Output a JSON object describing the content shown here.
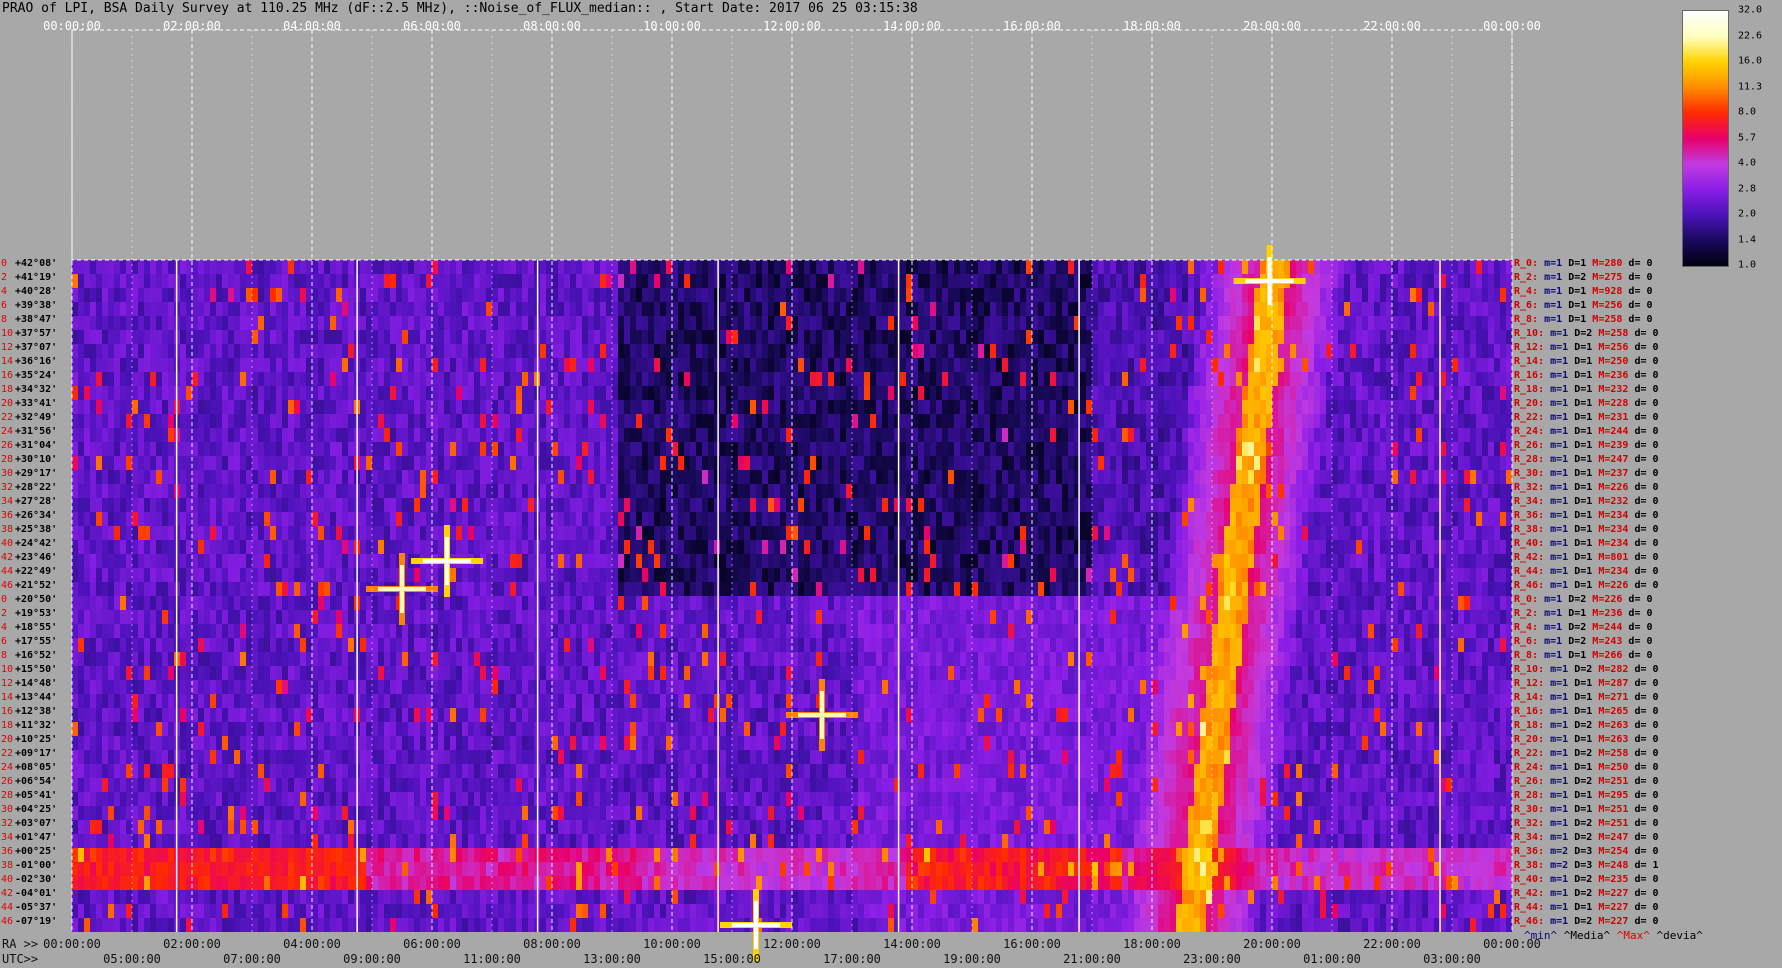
{
  "title": "PRAO of LPI, BSA Daily Survey at 110.25 MHz (dF::2.5 MHz), ::Noise_of_FLUX_median:: , Start Date: 2017 06 25 03:15:38",
  "top_ticks": [
    "00:00:00",
    "02:00:00",
    "04:00:00",
    "06:00:00",
    "08:00:00",
    "10:00:00",
    "12:00:00",
    "14:00:00",
    "16:00:00",
    "18:00:00",
    "20:00:00",
    "22:00:00",
    "00:00:00"
  ],
  "ra_label": "RA >>",
  "ra_ticks": [
    "00:00:00",
    "02:00:00",
    "04:00:00",
    "06:00:00",
    "08:00:00",
    "10:00:00",
    "12:00:00",
    "14:00:00",
    "16:00:00",
    "18:00:00",
    "20:00:00",
    "22:00:00",
    "00:00:00"
  ],
  "utc_label": "UTC>>",
  "utc_ticks": [
    "05:00:00",
    "07:00:00",
    "09:00:00",
    "11:00:00",
    "13:00:00",
    "15:00:00",
    "17:00:00",
    "19:00:00",
    "21:00:00",
    "23:00:00",
    "01:00:00",
    "03:00:00"
  ],
  "colorbar_ticks": [
    "32.0",
    "22.6",
    "16.0",
    "11.3",
    "8.0",
    "5.7",
    "4.0",
    "2.8",
    "2.0",
    "1.4",
    "1.0"
  ],
  "legend": {
    "min": "^min^",
    "median": "^Media^",
    "max": "^Max^",
    "dev": "^devia^"
  },
  "dec_labels": [
    {
      "i": "0",
      "v": "+42°08'"
    },
    {
      "i": "2",
      "v": "+41°19'"
    },
    {
      "i": "4",
      "v": "+40°28'"
    },
    {
      "i": "6",
      "v": "+39°38'"
    },
    {
      "i": "8",
      "v": "+38°47'"
    },
    {
      "i": "10",
      "v": "+37°57'"
    },
    {
      "i": "12",
      "v": "+37°07'"
    },
    {
      "i": "14",
      "v": "+36°16'"
    },
    {
      "i": "16",
      "v": "+35°24'"
    },
    {
      "i": "18",
      "v": "+34°32'"
    },
    {
      "i": "20",
      "v": "+33°41'"
    },
    {
      "i": "22",
      "v": "+32°49'"
    },
    {
      "i": "24",
      "v": "+31°56'"
    },
    {
      "i": "26",
      "v": "+31°04'"
    },
    {
      "i": "28",
      "v": "+30°10'"
    },
    {
      "i": "30",
      "v": "+29°17'"
    },
    {
      "i": "32",
      "v": "+28°22'"
    },
    {
      "i": "34",
      "v": "+27°28'"
    },
    {
      "i": "36",
      "v": "+26°34'"
    },
    {
      "i": "38",
      "v": "+25°38'"
    },
    {
      "i": "40",
      "v": "+24°42'"
    },
    {
      "i": "42",
      "v": "+23°46'"
    },
    {
      "i": "44",
      "v": "+22°49'"
    },
    {
      "i": "46",
      "v": "+21°52'"
    },
    {
      "i": "0",
      "v": "+20°50'"
    },
    {
      "i": "2",
      "v": "+19°53'"
    },
    {
      "i": "4",
      "v": "+18°55'"
    },
    {
      "i": "6",
      "v": "+17°55'"
    },
    {
      "i": "8",
      "v": "+16°52'"
    },
    {
      "i": "10",
      "v": "+15°50'"
    },
    {
      "i": "12",
      "v": "+14°48'"
    },
    {
      "i": "14",
      "v": "+13°44'"
    },
    {
      "i": "16",
      "v": "+12°38'"
    },
    {
      "i": "18",
      "v": "+11°32'"
    },
    {
      "i": "20",
      "v": "+10°25'"
    },
    {
      "i": "22",
      "v": "+09°17'"
    },
    {
      "i": "24",
      "v": "+08°05'"
    },
    {
      "i": "26",
      "v": "+06°54'"
    },
    {
      "i": "28",
      "v": "+05°41'"
    },
    {
      "i": "30",
      "v": "+04°25'"
    },
    {
      "i": "32",
      "v": "+03°07'"
    },
    {
      "i": "34",
      "v": "+01°47'"
    },
    {
      "i": "36",
      "v": "+00°25'"
    },
    {
      "i": "38",
      "v": "-01°00'"
    },
    {
      "i": "40",
      "v": "-02°30'"
    },
    {
      "i": "42",
      "v": "-04°01'"
    },
    {
      "i": "44",
      "v": "-05°37'"
    },
    {
      "i": "46",
      "v": "-07°19'"
    }
  ],
  "row_labels": [
    {
      "r": "R_0:",
      "m": "m=1",
      "d": "D=1",
      "mx": "M=280",
      "dv": "d= 0"
    },
    {
      "r": "R_2:",
      "m": "m=1",
      "d": "D=2",
      "mx": "M=275",
      "dv": "d= 0"
    },
    {
      "r": "R_4:",
      "m": "m=1",
      "d": "D=1",
      "mx": "M=928",
      "dv": "d= 0"
    },
    {
      "r": "R_6:",
      "m": "m=1",
      "d": "D=1",
      "mx": "M=256",
      "dv": "d= 0"
    },
    {
      "r": "R_8:",
      "m": "m=1",
      "d": "D=1",
      "mx": "M=258",
      "dv": "d= 0"
    },
    {
      "r": "R_10:",
      "m": "m=1",
      "d": "D=2",
      "mx": "M=258",
      "dv": "d= 0"
    },
    {
      "r": "R_12:",
      "m": "m=1",
      "d": "D=1",
      "mx": "M=256",
      "dv": "d= 0"
    },
    {
      "r": "R_14:",
      "m": "m=1",
      "d": "D=1",
      "mx": "M=250",
      "dv": "d= 0"
    },
    {
      "r": "R_16:",
      "m": "m=1",
      "d": "D=1",
      "mx": "M=236",
      "dv": "d= 0"
    },
    {
      "r": "R_18:",
      "m": "m=1",
      "d": "D=1",
      "mx": "M=232",
      "dv": "d= 0"
    },
    {
      "r": "R_20:",
      "m": "m=1",
      "d": "D=1",
      "mx": "M=228",
      "dv": "d= 0"
    },
    {
      "r": "R_22:",
      "m": "m=1",
      "d": "D=1",
      "mx": "M=231",
      "dv": "d= 0"
    },
    {
      "r": "R_24:",
      "m": "m=1",
      "d": "D=1",
      "mx": "M=244",
      "dv": "d= 0"
    },
    {
      "r": "R_26:",
      "m": "m=1",
      "d": "D=1",
      "mx": "M=239",
      "dv": "d= 0"
    },
    {
      "r": "R_28:",
      "m": "m=1",
      "d": "D=1",
      "mx": "M=247",
      "dv": "d= 0"
    },
    {
      "r": "R_30:",
      "m": "m=1",
      "d": "D=1",
      "mx": "M=237",
      "dv": "d= 0"
    },
    {
      "r": "R_32:",
      "m": "m=1",
      "d": "D=1",
      "mx": "M=226",
      "dv": "d= 0"
    },
    {
      "r": "R_34:",
      "m": "m=1",
      "d": "D=1",
      "mx": "M=232",
      "dv": "d= 0"
    },
    {
      "r": "R_36:",
      "m": "m=1",
      "d": "D=1",
      "mx": "M=234",
      "dv": "d= 0"
    },
    {
      "r": "R_38:",
      "m": "m=1",
      "d": "D=1",
      "mx": "M=234",
      "dv": "d= 0"
    },
    {
      "r": "R_40:",
      "m": "m=1",
      "d": "D=1",
      "mx": "M=234",
      "dv": "d= 0"
    },
    {
      "r": "R_42:",
      "m": "m=1",
      "d": "D=1",
      "mx": "M=801",
      "dv": "d= 0"
    },
    {
      "r": "R_44:",
      "m": "m=1",
      "d": "D=1",
      "mx": "M=234",
      "dv": "d= 0"
    },
    {
      "r": "R_46:",
      "m": "m=1",
      "d": "D=1",
      "mx": "M=226",
      "dv": "d= 0"
    },
    {
      "r": "R_0:",
      "m": "m=1",
      "d": "D=2",
      "mx": "M=226",
      "dv": "d= 0"
    },
    {
      "r": "R_2:",
      "m": "m=1",
      "d": "D=1",
      "mx": "M=236",
      "dv": "d= 0"
    },
    {
      "r": "R_4:",
      "m": "m=1",
      "d": "D=2",
      "mx": "M=244",
      "dv": "d= 0"
    },
    {
      "r": "R_6:",
      "m": "m=1",
      "d": "D=2",
      "mx": "M=243",
      "dv": "d= 0"
    },
    {
      "r": "R_8:",
      "m": "m=1",
      "d": "D=1",
      "mx": "M=266",
      "dv": "d= 0"
    },
    {
      "r": "R_10:",
      "m": "m=1",
      "d": "D=2",
      "mx": "M=282",
      "dv": "d= 0"
    },
    {
      "r": "R_12:",
      "m": "m=1",
      "d": "D=1",
      "mx": "M=287",
      "dv": "d= 0"
    },
    {
      "r": "R_14:",
      "m": "m=1",
      "d": "D=1",
      "mx": "M=271",
      "dv": "d= 0"
    },
    {
      "r": "R_16:",
      "m": "m=1",
      "d": "D=1",
      "mx": "M=265",
      "dv": "d= 0"
    },
    {
      "r": "R_18:",
      "m": "m=1",
      "d": "D=2",
      "mx": "M=263",
      "dv": "d= 0"
    },
    {
      "r": "R_20:",
      "m": "m=1",
      "d": "D=1",
      "mx": "M=263",
      "dv": "d= 0"
    },
    {
      "r": "R_22:",
      "m": "m=1",
      "d": "D=2",
      "mx": "M=258",
      "dv": "d= 0"
    },
    {
      "r": "R_24:",
      "m": "m=1",
      "d": "D=1",
      "mx": "M=250",
      "dv": "d= 0"
    },
    {
      "r": "R_26:",
      "m": "m=1",
      "d": "D=2",
      "mx": "M=251",
      "dv": "d= 0"
    },
    {
      "r": "R_28:",
      "m": "m=1",
      "d": "D=1",
      "mx": "M=295",
      "dv": "d= 0"
    },
    {
      "r": "R_30:",
      "m": "m=1",
      "d": "D=1",
      "mx": "M=251",
      "dv": "d= 0"
    },
    {
      "r": "R_32:",
      "m": "m=1",
      "d": "D=2",
      "mx": "M=251",
      "dv": "d= 0"
    },
    {
      "r": "R_34:",
      "m": "m=1",
      "d": "D=2",
      "mx": "M=247",
      "dv": "d= 0"
    },
    {
      "r": "R_36:",
      "m": "m=2",
      "d": "D=3",
      "mx": "M=254",
      "dv": "d= 0"
    },
    {
      "r": "R_38:",
      "m": "m=2",
      "d": "D=3",
      "mx": "M=248",
      "dv": "d= 1"
    },
    {
      "r": "R_40:",
      "m": "m=1",
      "d": "D=2",
      "mx": "M=235",
      "dv": "d= 0"
    },
    {
      "r": "R_42:",
      "m": "m=1",
      "d": "D=2",
      "mx": "M=227",
      "dv": "d= 0"
    },
    {
      "r": "R_44:",
      "m": "m=1",
      "d": "D=1",
      "mx": "M=227",
      "dv": "d= 0"
    },
    {
      "r": "R_46:",
      "m": "m=1",
      "d": "D=2",
      "mx": "M=227",
      "dv": "d= 0"
    }
  ],
  "chart_data": {
    "type": "heatmap",
    "x_axis_top": "RA 00:00:00 - 24:00:00",
    "rows": 48,
    "colorscale": [
      "#000010",
      "#1a0a5e",
      "#4b12b8",
      "#8a1ee6",
      "#c23be0",
      "#e8006a",
      "#ff2a00",
      "#ff8c00",
      "#ffd200",
      "#ffffc0",
      "#ffffff"
    ],
    "colorscale_values": [
      1.0,
      1.4,
      2.0,
      2.8,
      4.0,
      5.7,
      8.0,
      11.3,
      16.0,
      22.6,
      32.0
    ],
    "features": [
      {
        "kind": "point_source",
        "ra_hours": 19.96,
        "row": 1,
        "intensity": 32
      },
      {
        "kind": "point_source",
        "ra_hours": 6.25,
        "row": 21,
        "intensity": 32
      },
      {
        "kind": "point_source",
        "ra_hours": 5.5,
        "row": 23,
        "intensity": 22
      },
      {
        "kind": "point_source",
        "ra_hours": 12.5,
        "row": 32,
        "intensity": 22
      },
      {
        "kind": "point_source",
        "ra_hours": 11.4,
        "row": 47,
        "intensity": 32
      },
      {
        "kind": "galactic_plane",
        "ra_hours_start": 18.6,
        "ra_hours_end": 20.0,
        "row_start": 47,
        "row_end": 0,
        "intensity": 11
      },
      {
        "kind": "horizontal_band",
        "row_start": 42,
        "row_end": 44,
        "ra_hours_start": 0,
        "ra_hours_end": 4.9,
        "intensity": 8
      }
    ]
  }
}
